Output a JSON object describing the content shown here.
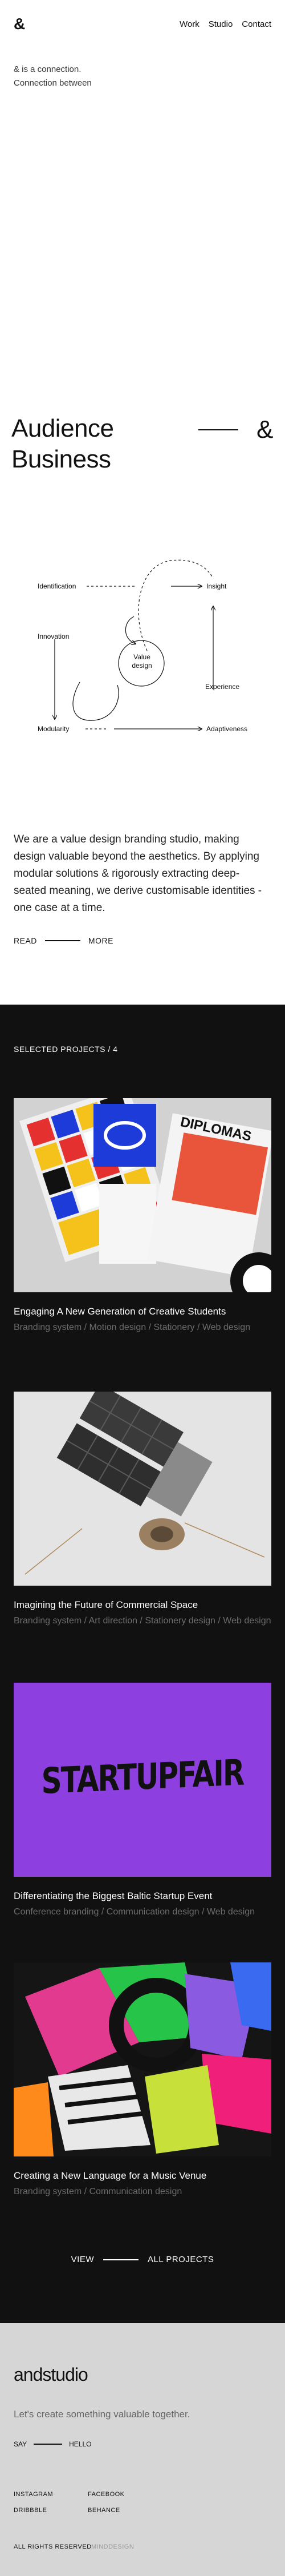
{
  "header": {
    "logo": "&",
    "nav": [
      "Work",
      "Studio",
      "Contact"
    ]
  },
  "tagline": [
    "& is a connection.",
    "Connection between"
  ],
  "hero": {
    "line1": "Audience",
    "line2": "Business",
    "amp": "&"
  },
  "diagram": {
    "labels": {
      "identification": "Identification",
      "insight": "Insight",
      "innovation": "Innovation",
      "value": "Value design",
      "experience": "Experience",
      "modularity": "Modularity",
      "adaptiveness": "Adaptiveness"
    }
  },
  "about": {
    "text": "We are a value design branding studio, making design valuable beyond the aesthetics. By applying modular solutions & rigorously extracting deep-seated meaning, we derive customisable identities - one case at a time.",
    "read": "READ",
    "more": "MORE"
  },
  "projects": {
    "title": "SELECTED PROJECTS / 4",
    "items": [
      {
        "title": "Engaging A New Generation of Creative Students",
        "tags": "Branding system / Motion design / Stationery / Web design"
      },
      {
        "title": "Imagining the Future of Commercial Space",
        "tags": "Branding system / Art direction / Stationery design / Web design"
      },
      {
        "title": "Differentiating the Biggest Baltic Startup Event",
        "tags": "Conference branding / Communication design / Web design",
        "image_text": "STARTUPFAIR"
      },
      {
        "title": "Creating a New Language for a Music Venue",
        "tags": "Branding system / Communication design"
      }
    ],
    "image_texts": {
      "diplomas": "DIPLOMAS"
    },
    "view": "VIEW",
    "all": "ALL PROJECTS"
  },
  "footer": {
    "brand": "andstudio",
    "cta": "Let's create something valuable together.",
    "say": "SAY",
    "hello": "HELLO",
    "social_left": [
      "INSTAGRAM",
      "DRIBBBLE"
    ],
    "social_right": [
      "FACEBOOK",
      "BEHANCE"
    ],
    "rights": "ALL RIGHTS RESERVED",
    "made": "MINDDESIGN"
  },
  "colors": {
    "dark_bg": "#111111",
    "footer_bg": "#d6d6d6",
    "startup_purple": "#8e3fe0"
  }
}
